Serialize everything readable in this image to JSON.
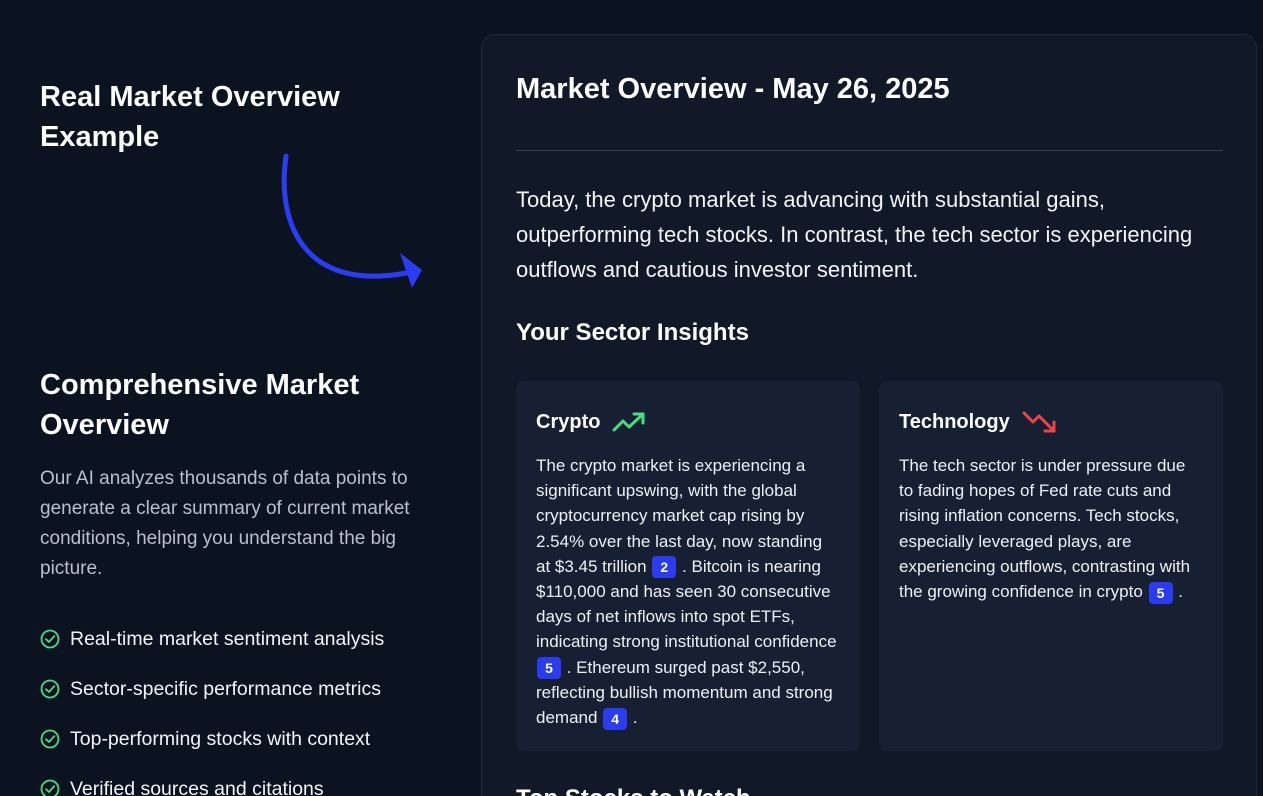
{
  "left": {
    "example_title": "Real Market Overview Example",
    "feature_title": "Comprehensive Market Overview",
    "feature_desc": "Our AI analyzes thousands of data points to generate a clear summary of current market conditions, helping you understand the big picture.",
    "features": [
      "Real-time market sentiment analysis",
      "Sector-specific performance metrics",
      "Top-performing stocks with context",
      "Verified sources and citations"
    ]
  },
  "panel": {
    "title": "Market Overview - May 26, 2025",
    "summary": "Today, the crypto market is advancing with substantial gains, outperforming tech stocks. In contrast, the tech sector is experiencing outflows and cautious investor sentiment.",
    "insights_title": "Your Sector Insights",
    "next_section_title": "Top Stocks to Watch"
  },
  "cards": {
    "crypto": {
      "name": "Crypto",
      "trend": "up",
      "trend_color": "#4ade80",
      "parts": [
        "The crypto market is experiencing a significant upswing, with the global cryptocurrency market cap rising by 2.54% over the last day, now standing at $3.45 trillion",
        ". Bitcoin is nearing $110,000 and has seen 30 consecutive days of net inflows into spot ETFs, indicating strong institutional confidence",
        ". Ethereum surged past $2,550, reflecting bullish momentum and strong demand",
        "."
      ],
      "citations": [
        "2",
        "5",
        "4"
      ]
    },
    "tech": {
      "name": "Technology",
      "trend": "down",
      "trend_color": "#ef4444",
      "parts": [
        "The tech sector is under pressure due to fading hopes of Fed rate cuts and rising inflation concerns. Tech stocks, especially leveraged plays, are experiencing outflows, contrasting with the growing confidence in crypto",
        "."
      ],
      "citations": [
        "5"
      ]
    }
  },
  "colors": {
    "background": "#0b1220",
    "panel": "#111827",
    "card": "#172033",
    "accent_arrow": "#2b3cf5",
    "citation": "#2a3bf0",
    "check": "#4ade80"
  }
}
